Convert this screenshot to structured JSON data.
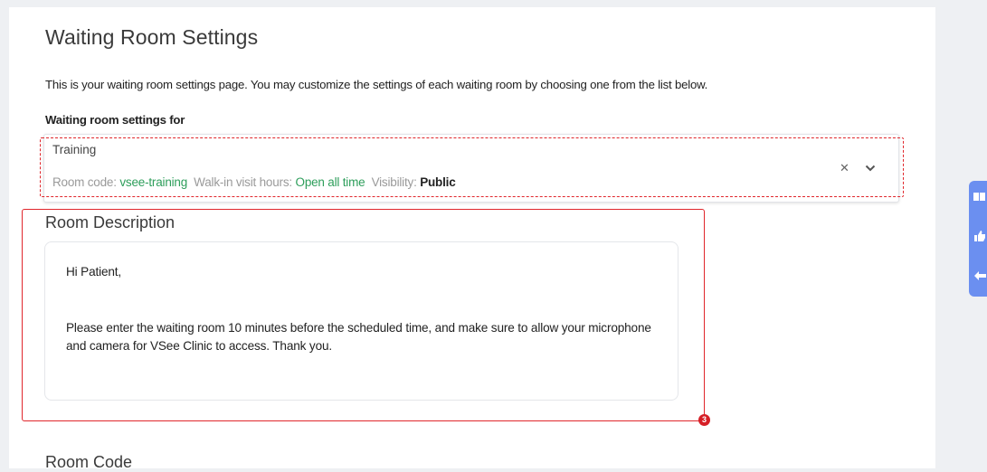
{
  "page": {
    "title": "Waiting Room Settings",
    "intro": "This is your waiting room settings page. You may customize the settings of each waiting room by choosing one from the list below.",
    "settings_for_label": "Waiting room settings for"
  },
  "selector": {
    "room_name": "Training",
    "room_code_label": "Room code:",
    "room_code_value": "vsee-training",
    "hours_label": "Walk-in visit hours:",
    "hours_value": "Open all time",
    "visibility_label": "Visibility:",
    "visibility_value": "Public",
    "clear_icon": "close-icon",
    "dropdown_icon": "chevron-down-icon"
  },
  "room_description": {
    "title": "Room Description",
    "greeting": "Hi Patient,",
    "body": "Please enter the waiting room 10 minutes before the scheduled time, and make sure to allow your microphone and camera for VSee Clinic to access. Thank you."
  },
  "annotation": {
    "badge_number": "3",
    "color": "#e0262b"
  },
  "room_code": {
    "title": "Room Code"
  },
  "side_toolbar": {
    "items": [
      "book-icon",
      "thumbs-up-icon",
      "back-arrow-icon"
    ],
    "color": "#6b8ff0"
  },
  "colors": {
    "accent_green": "#2e9e5b",
    "annotation_red": "#e0262b"
  }
}
